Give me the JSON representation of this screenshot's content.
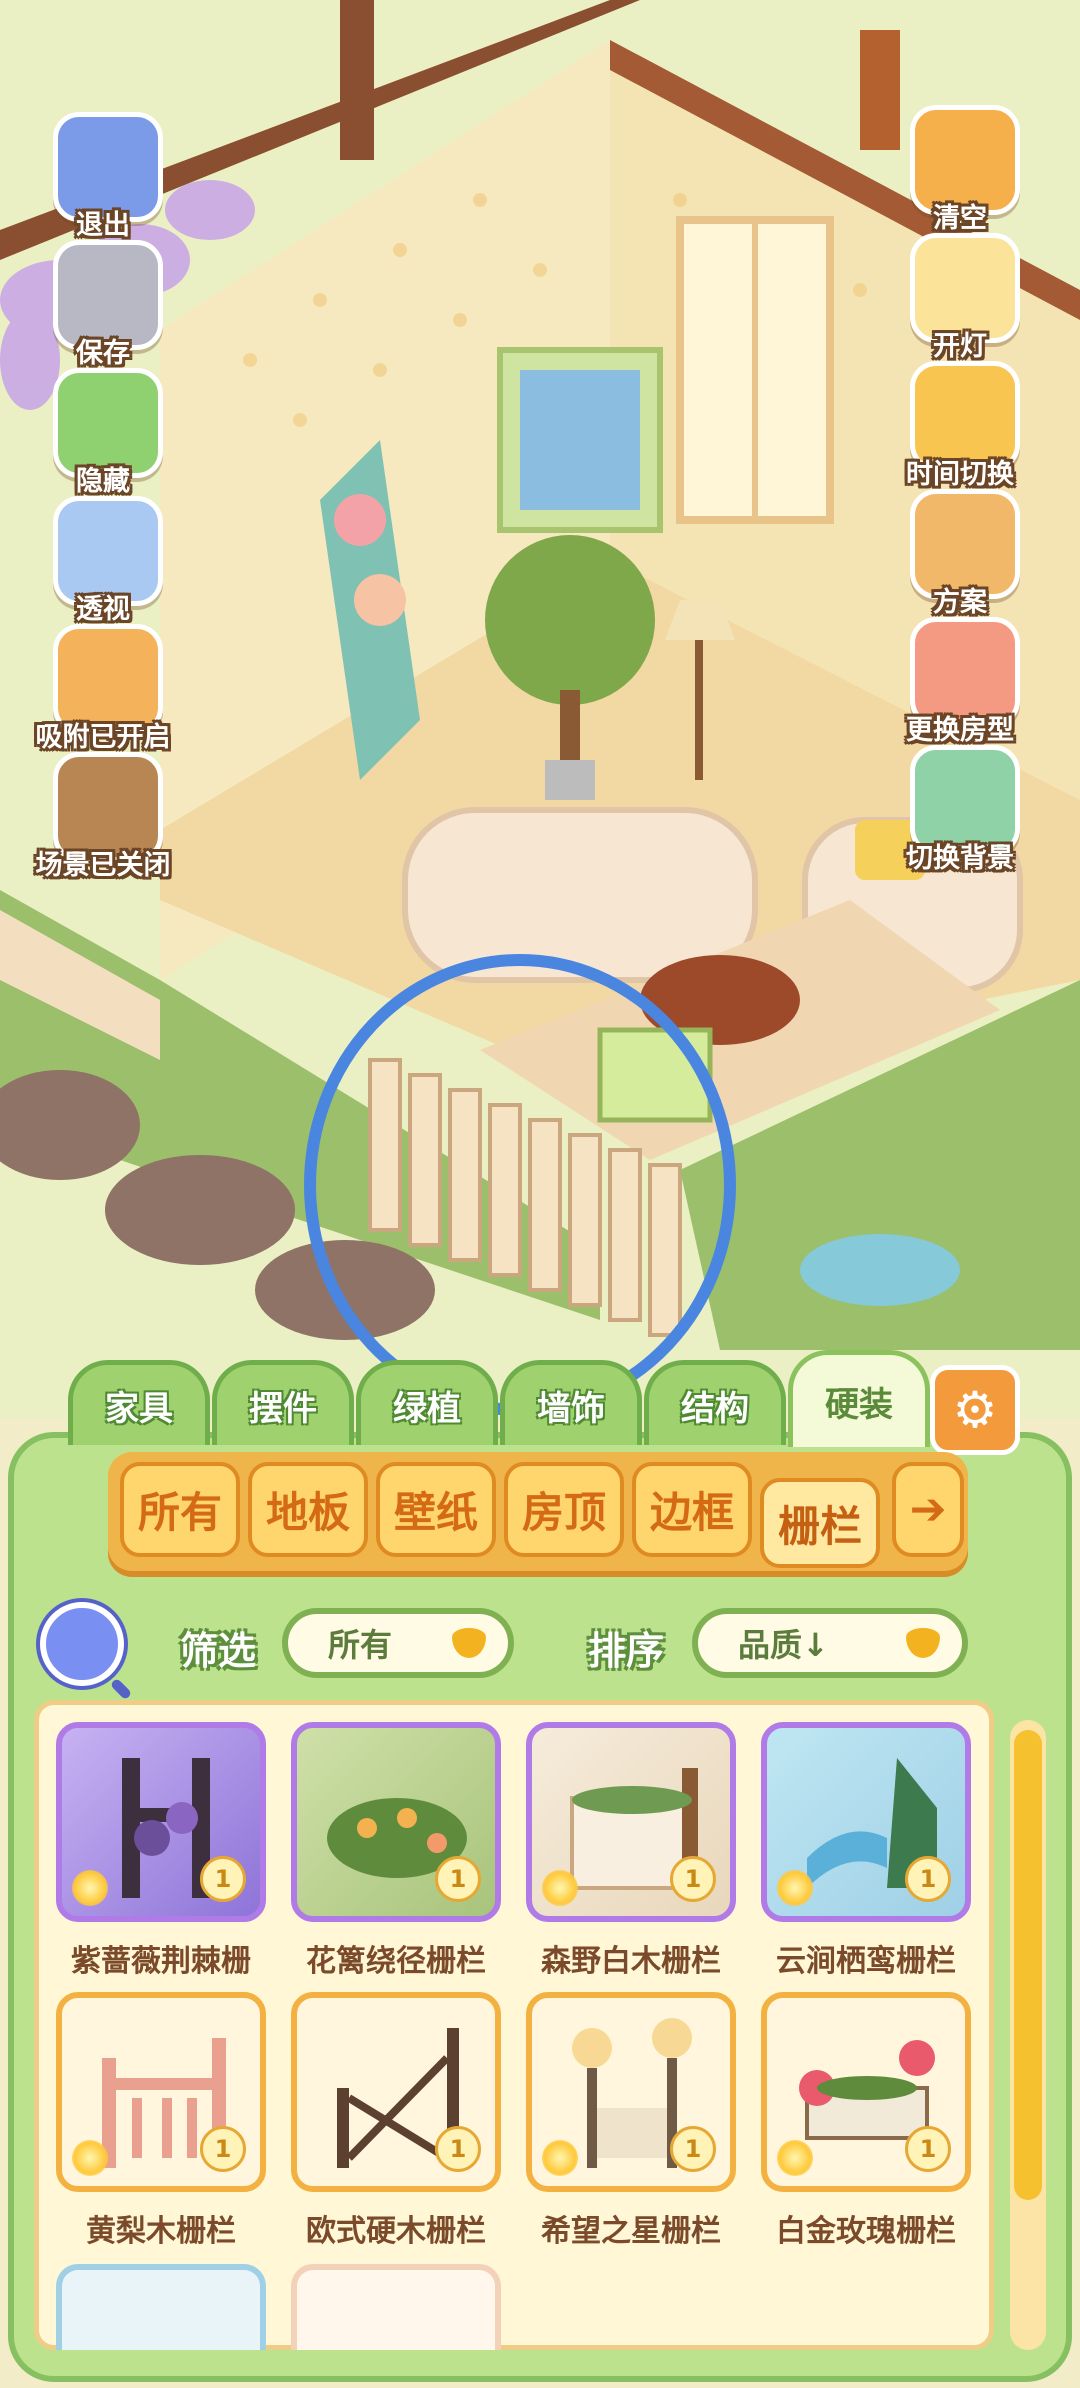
{
  "side_left": [
    {
      "label": "退出",
      "icon": "exit-door-icon"
    },
    {
      "label": "保存",
      "icon": "save-hamster-icon"
    },
    {
      "label": "隐藏",
      "icon": "hide-puzzle-icon"
    },
    {
      "label": "透视",
      "icon": "perspective-cube-icon"
    },
    {
      "label": "吸附已开启",
      "icon": "snap-cat-icon"
    },
    {
      "label": "场景已关闭",
      "icon": "scene-box-icon"
    }
  ],
  "side_right": [
    {
      "label": "清空",
      "icon": "clear-duck-icon"
    },
    {
      "label": "开灯",
      "icon": "light-lamp-icon"
    },
    {
      "label": "时间切换",
      "icon": "time-sun-icon"
    },
    {
      "label": "方案",
      "icon": "plan-book-icon"
    },
    {
      "label": "更换房型",
      "icon": "house-icon"
    },
    {
      "label": "切换背景",
      "icon": "background-icon"
    }
  ],
  "tabs": [
    "家具",
    "摆件",
    "绿植",
    "墙饰",
    "结构",
    "硬装"
  ],
  "active_tab": "硬装",
  "categories": [
    "所有",
    "地板",
    "壁纸",
    "房顶",
    "边框",
    "栅栏"
  ],
  "active_category": "栅栏",
  "filter": {
    "label": "筛选",
    "value": "所有"
  },
  "sort": {
    "label": "排序",
    "value": "品质↓"
  },
  "items": [
    {
      "name": "紫蔷薇荆棘栅",
      "count": "1"
    },
    {
      "name": "花篱绕径栅栏",
      "count": "1"
    },
    {
      "name": "森野白木栅栏",
      "count": "1"
    },
    {
      "name": "云涧栖鸾栅栏",
      "count": "1"
    },
    {
      "name": "黄梨木栅栏",
      "count": "1"
    },
    {
      "name": "欧式硬木栅栏",
      "count": "1"
    },
    {
      "name": "希望之星栅栏",
      "count": "1"
    },
    {
      "name": "白金玫瑰栅栏",
      "count": "1"
    }
  ],
  "colors": {
    "accent_green": "#86c060",
    "accent_orange": "#f0b54a",
    "highlight_blue": "#4a86e0"
  }
}
